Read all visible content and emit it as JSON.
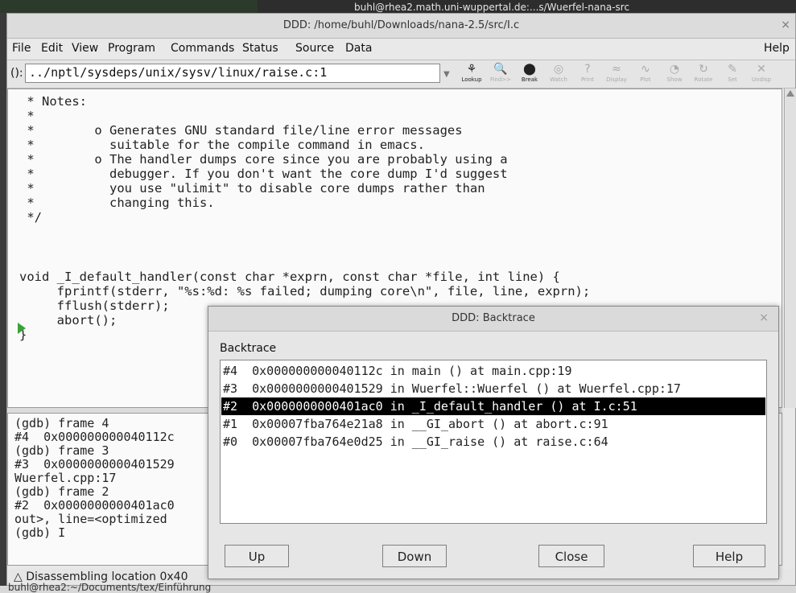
{
  "background": {
    "top_text": "buhl@rhea2.math.uni-wuppertal.de:...s/Wuerfel-nana-src",
    "bottom_text": "buhl@rhea2:~/Documents/tex/Einführung"
  },
  "window": {
    "title": "DDD: /home/buhl/Downloads/nana-2.5/src/I.c",
    "close_glyph": "×"
  },
  "menu": {
    "items": [
      "File",
      "Edit",
      "View",
      "Program",
      "Commands",
      "Status",
      "Source",
      "Data"
    ],
    "help": "Help"
  },
  "toolbar": {
    "arg_label": "():",
    "arg_value": "../nptl/sysdeps/unix/sysv/linux/raise.c:1",
    "buttons": [
      {
        "label": "Lookup",
        "icon": "⚘",
        "enabled": true
      },
      {
        "label": "Find>>",
        "icon": "🔍",
        "enabled": false
      },
      {
        "label": "Break",
        "icon": "⬤",
        "enabled": true
      },
      {
        "label": "Watch",
        "icon": "◎",
        "enabled": false
      },
      {
        "label": "Print",
        "icon": "?",
        "enabled": false
      },
      {
        "label": "Display",
        "icon": "≈",
        "enabled": false
      },
      {
        "label": "Plot",
        "icon": "∿",
        "enabled": false
      },
      {
        "label": "Show",
        "icon": "◔",
        "enabled": false
      },
      {
        "label": "Rotate",
        "icon": "↻",
        "enabled": false
      },
      {
        "label": "Set",
        "icon": "✎",
        "enabled": false
      },
      {
        "label": "Undisp",
        "icon": "✕",
        "enabled": false
      }
    ]
  },
  "source": {
    "lines": [
      " * Notes:",
      " *",
      " *        o Generates GNU standard file/line error messages",
      " *          suitable for the compile command in emacs.",
      " *        o The handler dumps core since you are probably using a",
      " *          debugger. If you don't want the core dump I'd suggest",
      " *          you use \"ulimit\" to disable core dumps rather than",
      " *          changing this.",
      " */",
      "",
      "void _I_default_handler(const char *exprn, const char *file, int line) {",
      "     fprintf(stderr, \"%s:%d: %s failed; dumping core\\n\", file, line, exprn);",
      "     fflush(stderr);",
      "     abort();",
      "}"
    ]
  },
  "console": {
    "lines": [
      "(gdb) frame 4",
      "#4  0x000000000040112c",
      "(gdb) frame 3",
      "#3  0x0000000000401529",
      "Wuerfel.cpp:17",
      "(gdb) frame 2",
      "#2  0x0000000000401ac0",
      "out>, line=<optimized",
      "(gdb) I"
    ]
  },
  "status": {
    "text": "△ Disassembling location 0x40"
  },
  "backtrace": {
    "title": "DDD: Backtrace",
    "close_glyph": "×",
    "label": "Backtrace",
    "frames": [
      "#4  0x000000000040112c in main () at main.cpp:19",
      "#3  0x0000000000401529 in Wuerfel::Wuerfel () at Wuerfel.cpp:17",
      "#2  0x0000000000401ac0 in _I_default_handler () at I.c:51",
      "#1  0x00007fba764e21a8 in __GI_abort () at abort.c:91",
      "#0  0x00007fba764e0d25 in __GI_raise () at raise.c:64"
    ],
    "selected_index": 2,
    "buttons": {
      "up": "Up",
      "down": "Down",
      "close": "Close",
      "help": "Help"
    }
  }
}
